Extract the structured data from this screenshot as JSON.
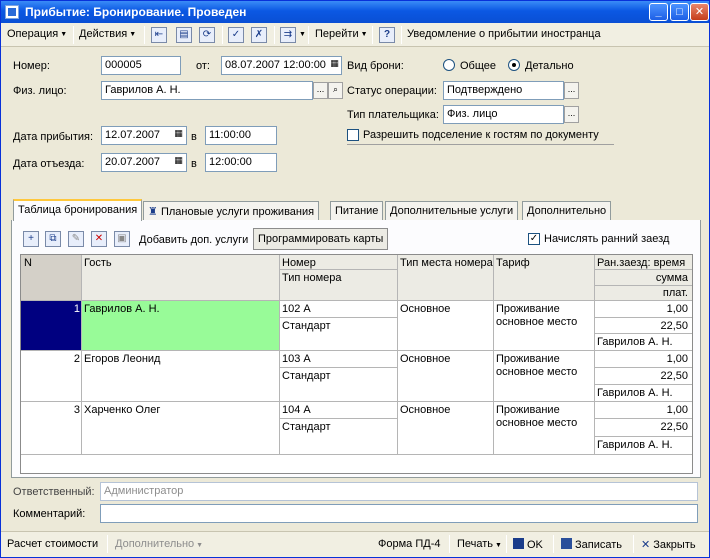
{
  "window": {
    "title": "Прибытие: Бронирование. Проведен"
  },
  "toolbar": {
    "operation": "Операция",
    "actions": "Действия",
    "goto": "Перейти",
    "help": "?",
    "notify": "Уведомление о прибытии иностранца"
  },
  "form": {
    "number_label": "Номер:",
    "number_value": "000005",
    "from_label": "от:",
    "from_value": "08.07.2007 12:00:00",
    "person_label": "Физ. лицо:",
    "person_value": "Гаврилов А. Н.",
    "arrival_label": "Дата прибытия:",
    "arrival_date": "12.07.2007",
    "arrival_at": "в",
    "arrival_time": "11:00:00",
    "departure_label": "Дата отъезда:",
    "departure_date": "20.07.2007",
    "departure_at": "в",
    "departure_time": "12:00:00",
    "booking_kind_label": "Вид брони:",
    "radio_general": "Общее",
    "radio_detail": "Детально",
    "op_status_label": "Статус операции:",
    "op_status_value": "Подтверждено",
    "payer_type_label": "Тип плательщика:",
    "payer_type_value": "Физ. лицо",
    "allow_share_label": "Разрешить подселение к гостям по документу"
  },
  "tabs": [
    "Таблица бронирования",
    "Плановые услуги проживания",
    "Питание",
    "Дополнительные услуги",
    "Дополнительно"
  ],
  "panel": {
    "add_services": "Добавить доп. услуги",
    "program_cards": "Программировать карты",
    "early_checkin": "Начислять ранний заезд"
  },
  "table": {
    "headers": {
      "n": "N",
      "guest": "Гость",
      "room": "Номер",
      "room_type": "Тип номера",
      "place_type": "Тип места номера",
      "tariff": "Тариф",
      "early_time": "Ран.заезд: время",
      "early_sum": "сумма",
      "early_payer": "плат."
    },
    "rows": [
      {
        "n": "1",
        "guest": "Гаврилов А. Н.",
        "room": "102 А",
        "room_type": "Стандарт",
        "place": "Основное",
        "tariff1": "Проживание",
        "tariff2": "основное место",
        "time": "1,00",
        "sum": "22,50",
        "payer": "Гаврилов А. Н."
      },
      {
        "n": "2",
        "guest": "Егоров Леонид",
        "room": "103 А",
        "room_type": "Стандарт",
        "place": "Основное",
        "tariff1": "Проживание",
        "tariff2": "основное место",
        "time": "1,00",
        "sum": "22,50",
        "payer": "Гаврилов А. Н."
      },
      {
        "n": "3",
        "guest": "Харченко Олег",
        "room": "104 А",
        "room_type": "Стандарт",
        "place": "Основное",
        "tariff1": "Проживание",
        "tariff2": "основное место",
        "time": "1,00",
        "sum": "22,50",
        "payer": "Гаврилов А. Н."
      }
    ]
  },
  "footer": {
    "responsible_label": "Ответственный:",
    "responsible_value": "Администратор",
    "comment_label": "Комментарий:",
    "comment_value": ""
  },
  "bottom": {
    "calc": "Расчет стоимости",
    "extra": "Дополнительно",
    "form_pd4": "Форма ПД-4",
    "print": "Печать",
    "ok": "OK",
    "save": "Записать",
    "close": "Закрыть"
  },
  "colors": {
    "selected_row": "#000080",
    "guest_highlight": "#98fb98",
    "titlebar": "#0b58e3"
  }
}
